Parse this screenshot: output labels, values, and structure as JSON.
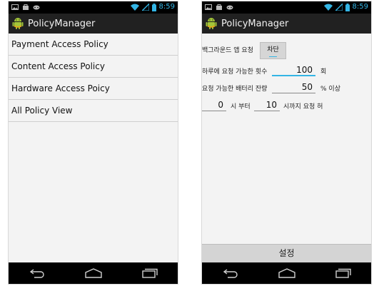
{
  "status_bar": {
    "time": "8:59",
    "icons": [
      "image-icon",
      "bag-icon",
      "gamepad-icon",
      "wifi-icon",
      "signal-icon",
      "battery-icon"
    ]
  },
  "app": {
    "title": "PolicyManager",
    "icon": "android-robot-icon"
  },
  "left_screen": {
    "items": [
      {
        "label": "Payment Access Policy"
      },
      {
        "label": "Content Access Policy"
      },
      {
        "label": "Hardware Access Poicy"
      },
      {
        "label": "All Policy View"
      }
    ]
  },
  "right_screen": {
    "background_request": {
      "label": "백그라운드 앱 요청",
      "button": "차단"
    },
    "daily_limit": {
      "label": "하루에 요청 가능한 횟수",
      "value": "100",
      "unit": "회"
    },
    "battery": {
      "label": "요청 가능한 배터리 잔량",
      "value": "50",
      "unit": "% 이상"
    },
    "time_range": {
      "from_value": "0",
      "from_label": "시 부터",
      "to_value": "10",
      "to_label": "시까지 요청 허"
    },
    "set_button": "설정"
  },
  "nav": {
    "back": "back-icon",
    "home": "home-icon",
    "recent": "recent-apps-icon"
  },
  "colors": {
    "accent": "#33b5e5",
    "action_bar": "#212121",
    "background": "#f3f3f3"
  }
}
